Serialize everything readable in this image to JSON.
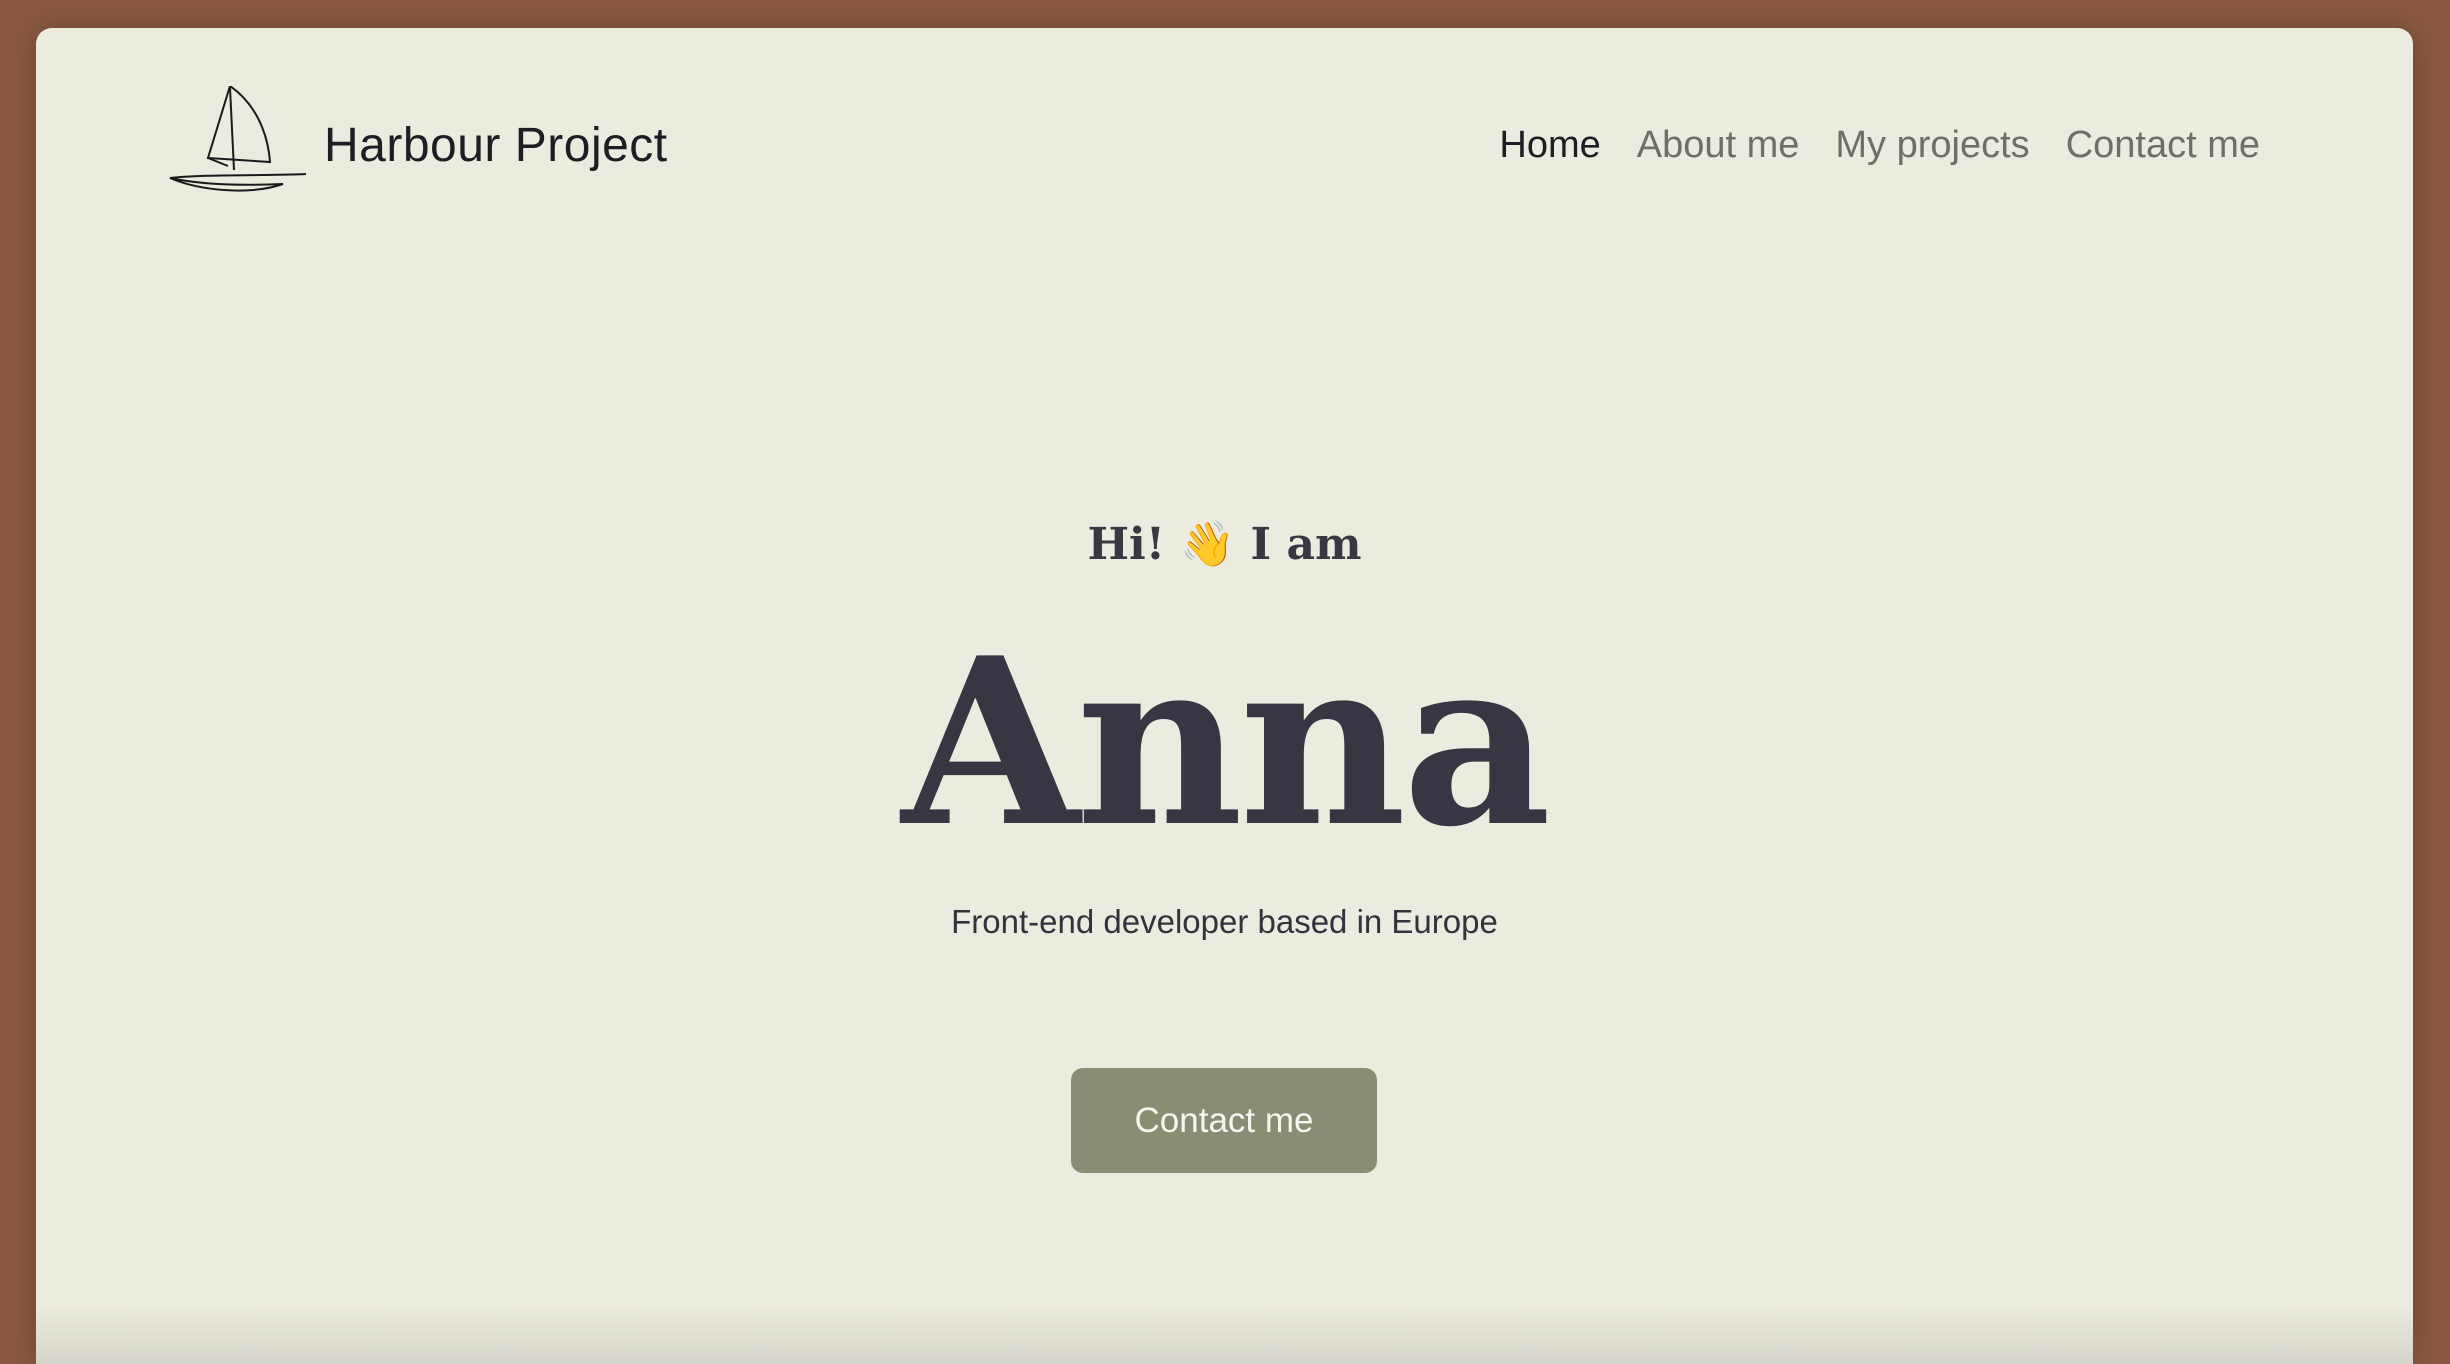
{
  "header": {
    "brand_name": "Harbour Project",
    "logo_icon": "sailboat-icon",
    "nav": [
      {
        "label": "Home",
        "active": true
      },
      {
        "label": "About me",
        "active": false
      },
      {
        "label": "My projects",
        "active": false
      },
      {
        "label": "Contact me",
        "active": false
      }
    ]
  },
  "hero": {
    "greeting_pre": "Hi!",
    "greeting_emoji": "👋",
    "greeting_post": "I am",
    "name": "Anna",
    "tagline": "Front-end developer based in Europe",
    "cta_label": "Contact me"
  },
  "colors": {
    "page_background": "#ecebdf",
    "outer_background": "#8a5a40",
    "button": "#888d73",
    "text_dark": "#373744",
    "nav_inactive": "#6f6f6a"
  }
}
